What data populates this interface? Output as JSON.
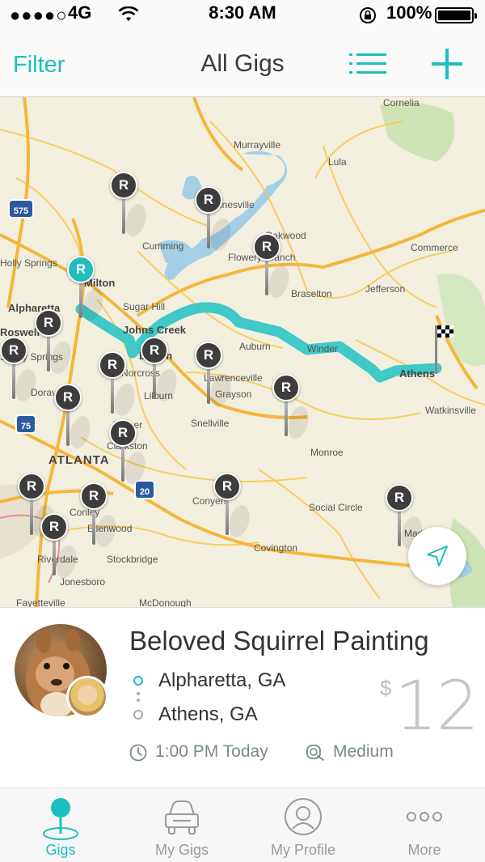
{
  "status_bar": {
    "signal": "●●●●○",
    "carrier": "4G",
    "time": "8:30 AM",
    "battery_text": "100%",
    "battery_level": 1.0
  },
  "nav": {
    "filter_label": "Filter",
    "title": "All Gigs",
    "list_icon": "list-icon",
    "add_icon": "plus-icon"
  },
  "colors": {
    "accent": "#1bbfbd",
    "pin": "#3d3d3d",
    "route": "#2ec4c4"
  },
  "map": {
    "towns": [
      "Cornelia",
      "Murrayville",
      "Lula",
      "Gainesville",
      "Oakwood",
      "Flowery Branch",
      "Commerce",
      "Jefferson",
      "Braselton",
      "Cumming",
      "Holly Springs",
      "Milton",
      "Alpharetta",
      "Sugar Hill",
      "Roswell",
      "Johns Creek",
      "Duluth",
      "Norcross",
      "Auburn",
      "Winder",
      "Athens",
      "Watkinsville",
      "Lawrenceville",
      "Grayson",
      "Lilburn",
      "Doraville",
      "Tucker",
      "Clarkston",
      "Snellville",
      "Monroe",
      "ATLANTA",
      "Conyers",
      "Social Circle",
      "Conley",
      "Ellenwood",
      "Covington",
      "Riverdale",
      "Stockbridge",
      "Jonesboro",
      "Fayetteville",
      "McDonough",
      "Madison",
      "Sandy Springs"
    ],
    "highway_shields": [
      "575",
      "75",
      "20"
    ],
    "pin_letter": "R",
    "locate_icon": "navigation-arrow-icon",
    "flag_icon": "checkered-flag-icon"
  },
  "gig": {
    "title": "Beloved Squirrel Painting",
    "origin": "Alpharetta, GA",
    "destination": "Athens, GA",
    "currency": "$",
    "price": "12",
    "time": "1:00 PM Today",
    "size": "Medium"
  },
  "tabs": [
    {
      "label": "Gigs",
      "icon": "map-pin-icon",
      "active": true
    },
    {
      "label": "My Gigs",
      "icon": "car-icon",
      "active": false
    },
    {
      "label": "My Profile",
      "icon": "profile-icon",
      "active": false
    },
    {
      "label": "More",
      "icon": "more-dots-icon",
      "active": false
    }
  ]
}
